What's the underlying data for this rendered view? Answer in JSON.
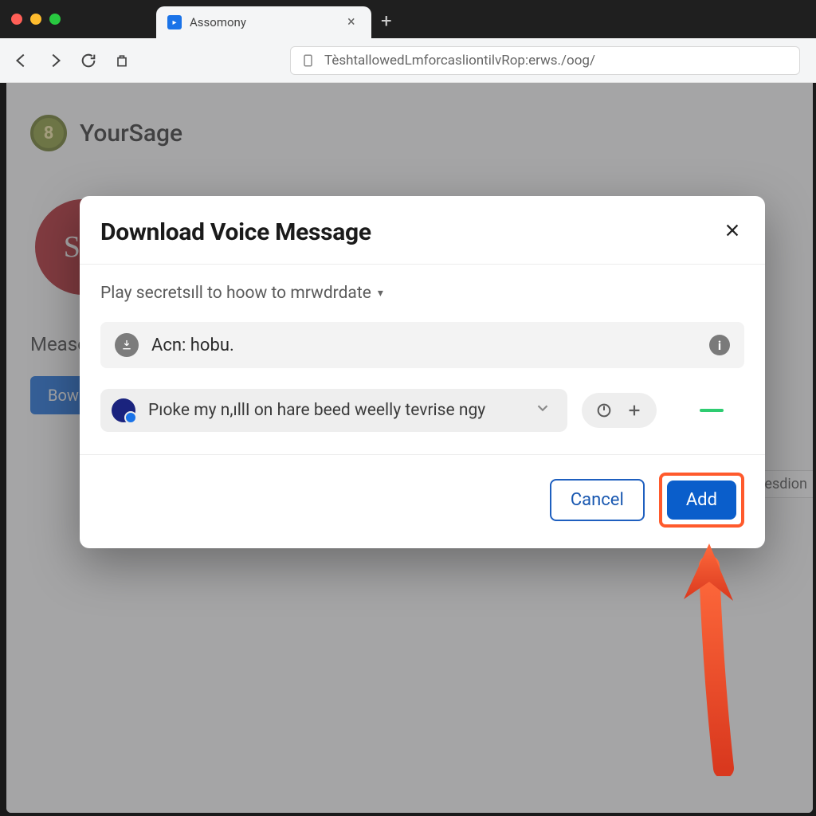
{
  "browser": {
    "tab_title": "Assomony",
    "url": "TèshtallowedLmforcasliontilvRop:erws./oog/"
  },
  "page": {
    "brand": "YourSage",
    "red_badge": "Sci",
    "bg_label": "Mease",
    "bg_button": "Bow",
    "side_chip": "lesdion"
  },
  "modal": {
    "title": "Download Voice Message",
    "subtitle": "Play secretsıll to hoow to mrwdrdate",
    "field1_text": "Acn: hobu.",
    "select_text": "Pıoke my n,ıllI on hare beed weelly tevrise ngy",
    "cancel_label": "Cancel",
    "add_label": "Add"
  }
}
